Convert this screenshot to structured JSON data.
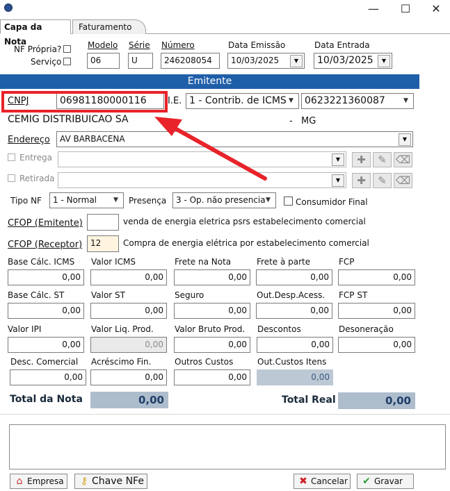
{
  "window": {
    "minimize": "—",
    "maximize": "☐",
    "close": "✕"
  },
  "tabs": [
    {
      "label": "Capa da Nota"
    },
    {
      "label": "Faturamento"
    }
  ],
  "header": {
    "nf_propria_label": "NF Própria?",
    "servico_label": "Serviço",
    "modelo_label": "Modelo",
    "modelo_value": "06",
    "serie_label": "Série",
    "serie_value": "U",
    "numero_label": "Número",
    "numero_value": "246208054",
    "data_emissao_label": "Data Emissão",
    "data_emissao_value": "10/03/2025",
    "data_entrada_label": "Data Entrada",
    "data_entrada_value": "10/03/2025"
  },
  "emitente": {
    "section_title": "Emitente",
    "cnpj_label": "CNPJ",
    "cnpj_value": "06981180000116",
    "ie_label": "I.E.",
    "ie_type_value": "1 - Contrib. de ICMS",
    "ie_value": "0623221360087",
    "name": "CEMIG DISTRIBUICAO SA",
    "city_sep": "-",
    "uf": "MG",
    "endereco_label": "Endereço",
    "endereco_value": "AV BARBACENA",
    "entrega_label": "Entrega",
    "retirada_label": "Retirada"
  },
  "nf": {
    "tipo_label": "Tipo NF",
    "tipo_value": "1 - Normal",
    "presenca_label": "Presença",
    "presenca_value": "3 - Op. não presencia",
    "consumidor_label": "Consumidor Final",
    "cfop_emitente_label": "CFOP (Emitente)",
    "cfop_emitente_value": "",
    "cfop_emitente_desc": "venda de energia eletrica psrs estabelecimento comercial",
    "cfop_receptor_label": "CFOP (Receptor)",
    "cfop_receptor_value": "12",
    "cfop_receptor_desc": "Compra de energia elétrica por estabelecimento comercial"
  },
  "values": {
    "base_icms": {
      "label": "Base Cálc. ICMS",
      "value": "0,00"
    },
    "valor_icms": {
      "label": "Valor ICMS",
      "value": "0,00"
    },
    "frete_nota": {
      "label": "Frete na Nota",
      "value": "0,00"
    },
    "frete_parte": {
      "label": "Frete à parte",
      "value": "0,00"
    },
    "fcp": {
      "label": "FCP",
      "value": "0,00"
    },
    "base_st": {
      "label": "Base Cálc. ST",
      "value": "0,00"
    },
    "valor_st": {
      "label": "Valor ST",
      "value": "0,00"
    },
    "seguro": {
      "label": "Seguro",
      "value": "0,00"
    },
    "out_desp": {
      "label": "Out.Desp.Acess.",
      "value": "0,00"
    },
    "fcp_st": {
      "label": "FCP ST",
      "value": "0,00"
    },
    "valor_ipi": {
      "label": "Valor IPI",
      "value": "0,00"
    },
    "valor_liq": {
      "label": "Valor Liq. Prod.",
      "value": "0,00"
    },
    "valor_bruto": {
      "label": "Valor Bruto Prod.",
      "value": "0,00"
    },
    "descontos": {
      "label": "Descontos",
      "value": "0,00"
    },
    "desoneracao": {
      "label": "Desoneração",
      "value": "0,00"
    },
    "desc_comercial": {
      "label": "Desc. Comercial",
      "value": "0,00"
    },
    "acrescimo": {
      "label": "Acréscimo Fin.",
      "value": "0,00"
    },
    "outros_custos": {
      "label": "Outros Custos",
      "value": "0,00"
    },
    "out_custos_itens": {
      "label": "Out.Custos Itens",
      "value": "0,00"
    }
  },
  "totals": {
    "total_nota_label": "Total da Nota",
    "total_nota_value": "0,00",
    "total_real_label": "Total Real",
    "total_real_value": "0,00"
  },
  "buttons": {
    "empresa": "Empresa",
    "chave": "Chave NFe",
    "cancelar": "Cancelar",
    "gravar": "Gravar"
  },
  "colors": {
    "accent_blue": "#1f5fa8",
    "highlight_red": "#e8232a",
    "total_bg": "#aebdcc"
  }
}
